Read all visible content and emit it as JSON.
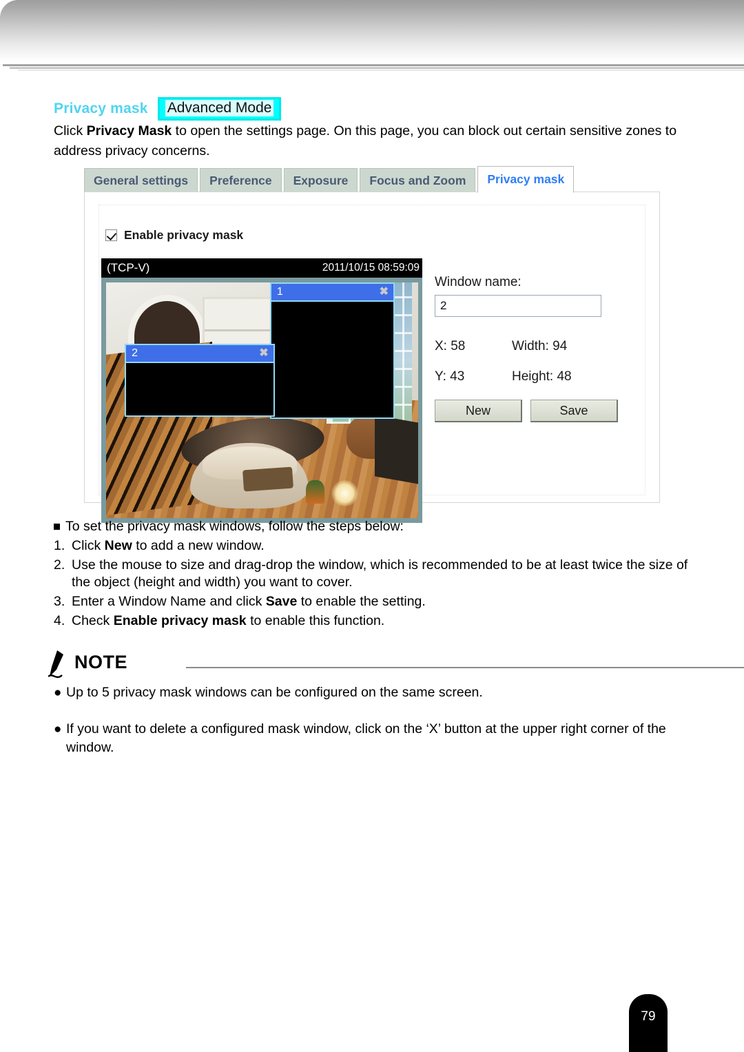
{
  "document": {
    "page_number": "79"
  },
  "section": {
    "title": "Privacy mask",
    "mode_badge": "Advanced Mode",
    "intro_prefix": "Click ",
    "intro_bold": "Privacy Mask",
    "intro_suffix": " to open the settings page. On this page, you can block out certain sensitive zones to address privacy concerns."
  },
  "screenshot": {
    "tabs": [
      {
        "label": "General settings",
        "active": false
      },
      {
        "label": "Preference",
        "active": false
      },
      {
        "label": "Exposure",
        "active": false
      },
      {
        "label": "Focus and Zoom",
        "active": false
      },
      {
        "label": "Privacy mask",
        "active": true
      }
    ],
    "enable_checkbox": {
      "label": "Enable privacy mask",
      "checked": true
    },
    "video": {
      "osd_protocol": "(TCP-V)",
      "osd_timestamp": "2011/10/15  08:59:09",
      "mask_windows": [
        {
          "number": "1",
          "close": "✖"
        },
        {
          "number": "2",
          "close": "✖"
        }
      ]
    },
    "form": {
      "window_name_label": "Window name:",
      "window_name_value": "2",
      "x_label": "X: 58",
      "width_label": "Width: 94",
      "y_label": "Y: 43",
      "height_label": "Height: 48",
      "new_button": "New",
      "save_button": "Save"
    }
  },
  "steps": {
    "intro": "To set the privacy mask windows, follow the steps below:",
    "items": [
      {
        "marker": "1.",
        "pre": "Click ",
        "bold": "New",
        "post": " to add a new window."
      },
      {
        "marker": "2.",
        "pre": "Use the mouse to size and drag-drop the window, which is recommended to be at least twice the size of the object (height and width) you want to cover.",
        "bold": "",
        "post": ""
      },
      {
        "marker": "3.",
        "pre": "Enter a Window Name and click ",
        "bold": "Save",
        "post": " to enable the setting."
      },
      {
        "marker": "4.",
        "pre": "Check ",
        "bold": "Enable privacy mask",
        "post": " to enable this function."
      }
    ]
  },
  "note": {
    "heading": "NOTE",
    "items": [
      "Up to 5 privacy mask windows can be configured on the same screen.",
      "If you want to delete a configured mask window, click on the ‘X’ button at the upper right corner of the window."
    ]
  },
  "colors": {
    "accent_cyan": "#4fd5f0",
    "badge_cyan": "#00ffff",
    "tab_bg": "#ccd8cf",
    "tab_text": "#4a5a74",
    "active_tab_text": "#2f7ef5",
    "mask_title_blue": "#3f6fe8",
    "mask_border": "#8fd8f5",
    "video_frame": "#7a9a9e"
  }
}
